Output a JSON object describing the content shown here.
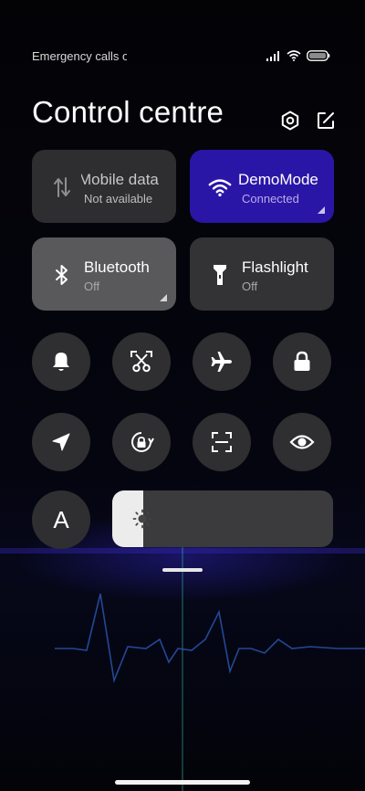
{
  "status_bar": {
    "carrier_text": "Emergency calls o",
    "icons": [
      "signal-icon",
      "wifi-icon",
      "battery-icon"
    ]
  },
  "header": {
    "title": "Control centre",
    "icons": [
      "settings-icon",
      "edit-icon"
    ]
  },
  "tiles": [
    {
      "id": "mobile-data",
      "label": "Mobile data",
      "status": "Not available",
      "icon": "mobile-data-icon",
      "state": "disabled"
    },
    {
      "id": "wifi",
      "label": "DemoMode",
      "status": "Connected",
      "icon": "wifi-icon",
      "state": "active"
    },
    {
      "id": "bluetooth",
      "label": "Bluetooth",
      "status": "Off",
      "icon": "bluetooth-icon",
      "state": "off"
    },
    {
      "id": "flashlight",
      "label": "Flashlight",
      "status": "Off",
      "icon": "flashlight-icon",
      "state": "off"
    }
  ],
  "toggles": [
    {
      "id": "sound",
      "icon": "bell-icon"
    },
    {
      "id": "screenshot",
      "icon": "scissors-screenshot-icon"
    },
    {
      "id": "airplane",
      "icon": "airplane-icon"
    },
    {
      "id": "lock",
      "icon": "lock-icon"
    },
    {
      "id": "location",
      "icon": "location-arrow-icon"
    },
    {
      "id": "rotation",
      "icon": "rotation-lock-icon"
    },
    {
      "id": "scanner",
      "icon": "scan-icon"
    },
    {
      "id": "reading-mode",
      "icon": "eye-icon"
    },
    {
      "id": "auto-brightness",
      "icon": "auto-brightness-icon",
      "text": "A"
    }
  ],
  "brightness": {
    "level": 0.14,
    "icon": "sun-icon"
  },
  "colors": {
    "accent": "#2a16a6",
    "tile_bg": "#2f2f31",
    "tile_light": "#59595b"
  }
}
